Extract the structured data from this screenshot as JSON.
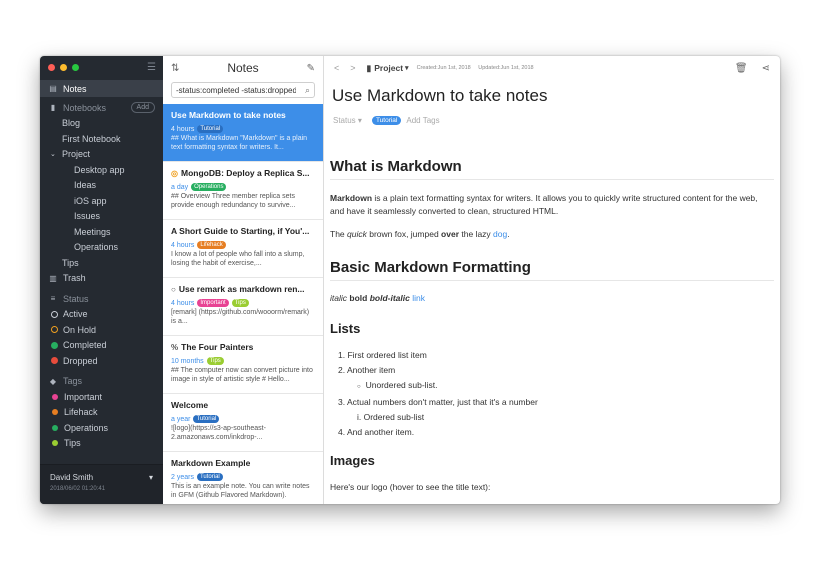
{
  "sidebar": {
    "notes": "Notes",
    "notebooks": "Notebooks",
    "add": "Add",
    "notebook_items": [
      "Blog",
      "First Notebook",
      "Project",
      "Desktop app",
      "Ideas",
      "iOS app",
      "Issues",
      "Meetings",
      "Operations",
      "Tips"
    ],
    "trash": "Trash",
    "status": "Status",
    "statuses": [
      "Active",
      "On Hold",
      "Completed",
      "Dropped"
    ],
    "tags": "Tags",
    "tag_items": [
      "Important",
      "Lifehack",
      "Operations",
      "Tips"
    ],
    "user": "David Smith",
    "user_date": "2018/06/02 01:20:41"
  },
  "notes_panel": {
    "title": "Notes",
    "search_value": "-status:completed -status:dropped",
    "notes": [
      {
        "title": "Use Markdown to take notes",
        "time": "4 hours",
        "tags": [
          "Tutorial"
        ],
        "snippet": "## What is Markdown \"Markdown\" is a plain text formatting syntax for writers. It..."
      },
      {
        "title": "MongoDB: Deploy a Replica S...",
        "time": "a day",
        "tags": [
          "Operations"
        ],
        "snippet": "## Overview Three member replica sets provide enough redundancy to survive..."
      },
      {
        "title": "A Short Guide to Starting, if You'...",
        "time": "4 hours",
        "tags": [
          "Lifehack"
        ],
        "snippet": "I know a lot of people who fall into a slump, losing the habit of exercise,..."
      },
      {
        "title": "Use remark as markdown ren...",
        "time": "4 hours",
        "tags": [
          "Important",
          "Tips"
        ],
        "snippet": "[remark] (https://github.com/wooorm/remark) is a..."
      },
      {
        "title": "The Four Painters",
        "time": "10 months",
        "tags": [
          "Tips"
        ],
        "snippet": "## The computer now can convert picture into image in style of artistic style # Hello..."
      },
      {
        "title": "Welcome",
        "time": "a year",
        "tags": [
          "Tutorial"
        ],
        "snippet": "![logo](https://s3-ap-southeast-2.amazonaws.com/inkdrop-..."
      },
      {
        "title": "Markdown Example",
        "time": "2 years",
        "tags": [
          "Tutorial"
        ],
        "snippet": "This is an example note. You can write notes in GFM (Github Flavored Markdown)."
      }
    ]
  },
  "editor": {
    "notebook": "Project",
    "created": "Created:Jun 1st, 2018",
    "updated": "Updated:Jun 1st, 2018",
    "title": "Use Markdown to take notes",
    "status": "Status",
    "tag": "Tutorial",
    "add_tags": "Add Tags",
    "h_what": "What is Markdown",
    "p1_bold": "Markdown",
    "p1_rest": " is a plain text formatting syntax for writers. It allows you to quickly write structured content for the web, and have it seamlessly converted to clean, structured HTML.",
    "p2_a": "The ",
    "p2_quick": "quick",
    "p2_b": " brown fox, jumped ",
    "p2_over": "over",
    "p2_c": " the lazy ",
    "p2_dog": "dog",
    "p2_d": ".",
    "h_basic": "Basic Markdown Formatting",
    "fmt_italic": "italic",
    "fmt_bold": "bold",
    "fmt_bolditalic": "bold-italic",
    "fmt_link": "link",
    "h_lists": "Lists",
    "list": [
      "1. First ordered list item",
      "2. Another item",
      "Unordered sub-list.",
      "3. Actual numbers don't matter, just that it's a number",
      "i. Ordered sub-list",
      "4. And another item."
    ],
    "h_images": "Images",
    "images_p": "Here's our logo (hover to see the title text):"
  },
  "colors": {
    "accent": "#3d8ee8",
    "sidebar": "#252a31",
    "tutorial": "#3d8ee8",
    "operations": "#27ae60",
    "lifehack": "#e67e22",
    "important": "#e84393",
    "tips": "#9acd32"
  }
}
